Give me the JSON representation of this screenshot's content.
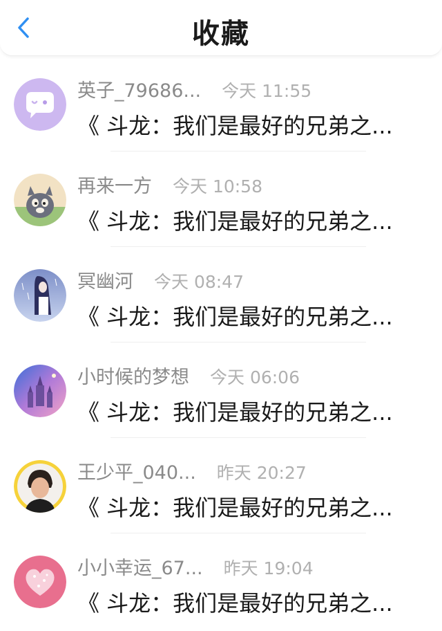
{
  "header": {
    "title": "收藏"
  },
  "items": [
    {
      "name": "英子_79686...",
      "time": "今天 11:55",
      "message": "《 斗龙：我们是最好的兄弟之..."
    },
    {
      "name": "再来一方",
      "time": "今天 10:58",
      "message": "《 斗龙：我们是最好的兄弟之..."
    },
    {
      "name": "冥幽河",
      "time": "今天 08:47",
      "message": "《 斗龙：我们是最好的兄弟之..."
    },
    {
      "name": "小时候的梦想",
      "time": "今天 06:06",
      "message": "《 斗龙：我们是最好的兄弟之..."
    },
    {
      "name": "王少平_040...",
      "time": "昨天 20:27",
      "message": "《 斗龙：我们是最好的兄弟之..."
    },
    {
      "name": "小小幸运_67...",
      "time": "昨天 19:04",
      "message": "《 斗龙：我们是最好的兄弟之..."
    }
  ],
  "colors": {
    "accent": "#2f8ff2",
    "name_gray": "#8a8a8a",
    "time_gray": "#b0b0b0"
  }
}
